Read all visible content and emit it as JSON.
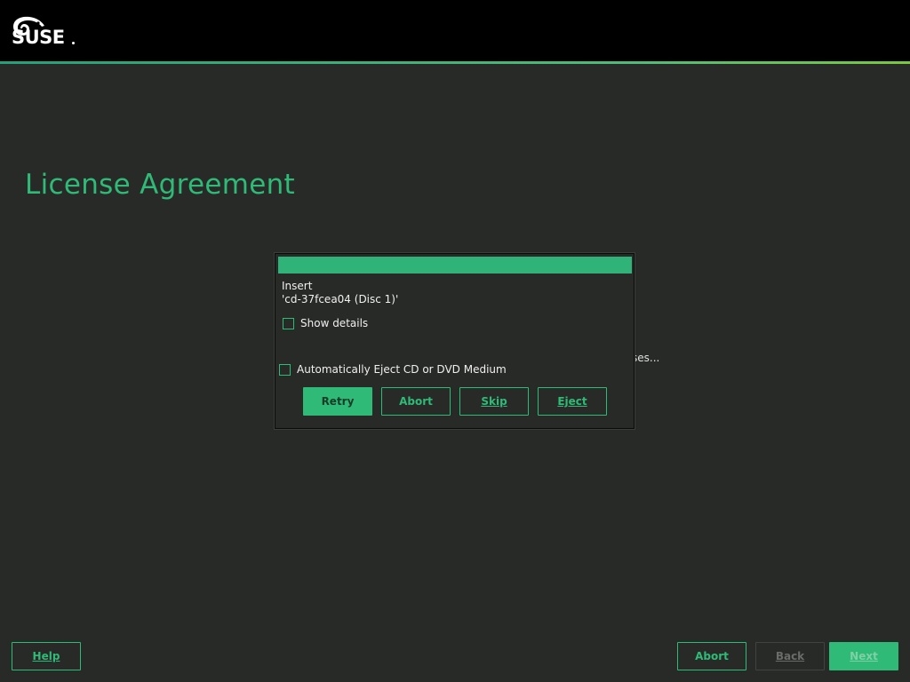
{
  "brand": {
    "logo_text": "SUSE",
    "colors": {
      "accent": "#30ba78",
      "background": "#282a27",
      "topbar": "#000000"
    }
  },
  "page": {
    "title": "License Agreement",
    "obscured_fragment": "ses..."
  },
  "dialog": {
    "line1": "Insert",
    "line2": "'cd-37fcea04 (Disc 1)'",
    "show_details": {
      "label": "Show details",
      "checked": false
    },
    "auto_eject": {
      "label": "Automatically Eject CD or DVD Medium",
      "checked": false
    },
    "buttons": {
      "retry": "Retry",
      "abort": "Abort",
      "skip": "Skip",
      "eject": "Eject"
    }
  },
  "footer": {
    "help": "Help",
    "abort": "Abort",
    "back": "Back",
    "next": "Next"
  }
}
